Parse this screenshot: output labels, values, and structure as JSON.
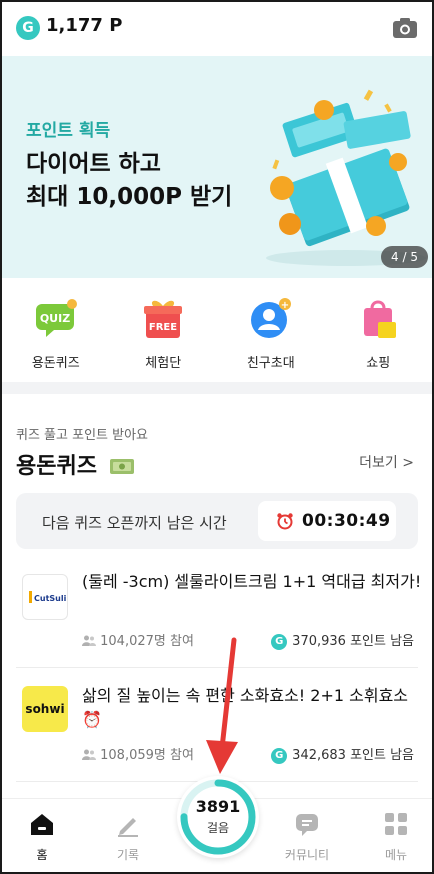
{
  "header": {
    "points": "1,177 P",
    "g_badge": "G"
  },
  "banner": {
    "subtitle": "포인트 획득",
    "title_line1": "다이어트 하고",
    "title_line2": "최대 10,000P 받기",
    "pager": "4 / 5"
  },
  "shortcuts": [
    {
      "label": "용돈퀴즈",
      "icon": "quiz-icon"
    },
    {
      "label": "체험단",
      "icon": "free-gift-icon"
    },
    {
      "label": "친구초대",
      "icon": "invite-friend-icon"
    },
    {
      "label": "쇼핑",
      "icon": "shopping-bag-icon"
    }
  ],
  "quiz_section": {
    "subtitle": "퀴즈 풀고 포인트 받아요",
    "title": "용돈퀴즈",
    "more": "더보기 >",
    "timer_label": "다음 퀴즈 오픈까지 남은 시간",
    "timer_value": "00:30:49"
  },
  "quizzes": [
    {
      "brand": "CutSulin",
      "title": "(둘레 -3cm) 셀룰라이트크림 1+1 역대급 최저가!",
      "participants": "104,027명 참여",
      "remaining": "370,936 포인트 남음"
    },
    {
      "brand": "sohwi",
      "title": "삶의 질 높이는 속 편한 소화효소! 2+1 소휘효소 ⏰",
      "participants": "108,059명 참여",
      "remaining": "342,683 포인트 남음"
    }
  ],
  "bottom_nav": {
    "home": "홈",
    "record": "기록",
    "steps_value": "3891",
    "steps_label": "걸음",
    "steps_progress": 0.75,
    "community": "커뮤니티",
    "menu": "메뉴"
  },
  "colors": {
    "accent": "#35c8c0",
    "banner_bg": "#e3f5f6",
    "annotation_arrow": "#e53935"
  }
}
